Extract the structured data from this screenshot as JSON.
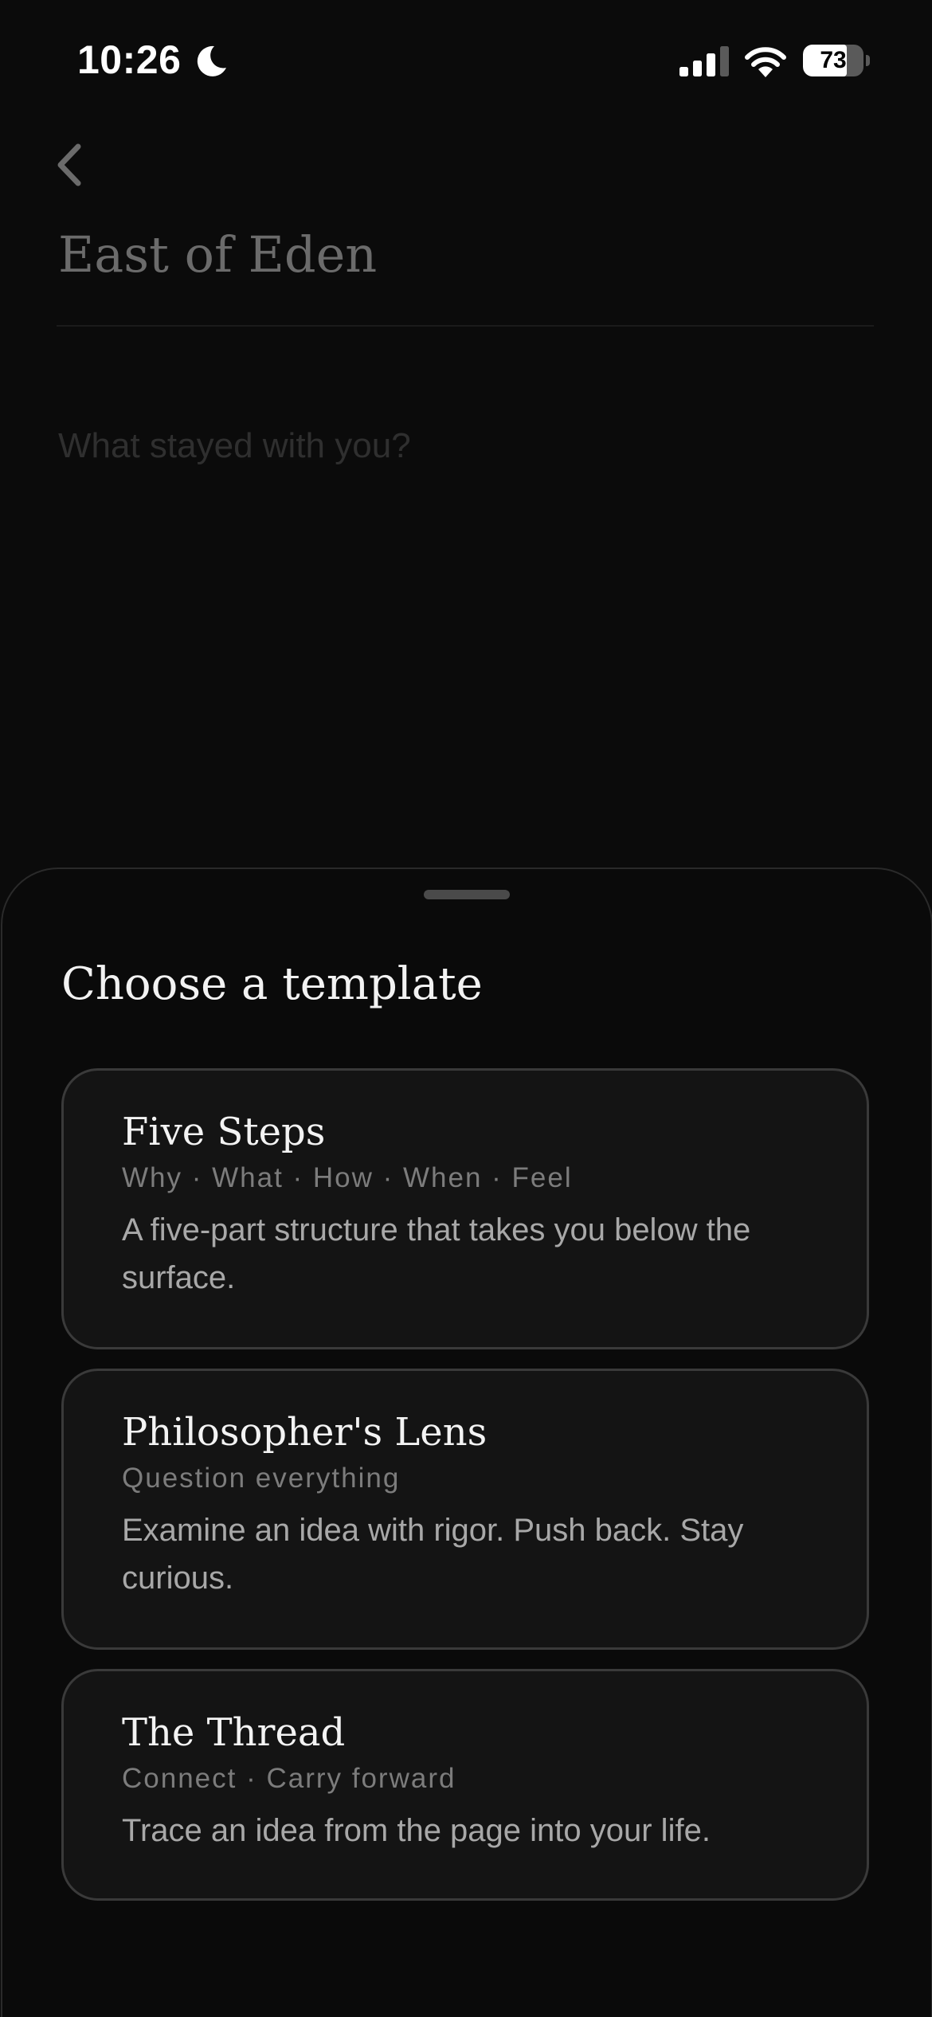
{
  "status_bar": {
    "time": "10:26",
    "battery_percent": "73",
    "battery_level": 0.73,
    "icons": [
      "moon-icon",
      "cellular-signal-icon",
      "wifi-icon",
      "battery-icon"
    ]
  },
  "editor": {
    "back_icon": "chevron-left-icon",
    "book_title": "East of Eden",
    "notes_placeholder": "What stayed with you?"
  },
  "sheet": {
    "title": "Choose a template",
    "templates": [
      {
        "name": "Five Steps",
        "tagline": "Why · What · How · When · Feel",
        "description": "A five-part structure that takes you below the surface."
      },
      {
        "name": "Philosopher's Lens",
        "tagline": "Question everything",
        "description": "Examine an idea with rigor. Push back. Stay curious."
      },
      {
        "name": "The Thread",
        "tagline": "Connect · Carry forward",
        "description": "Trace an idea from the page into your life."
      }
    ]
  },
  "colors": {
    "background": "#0b0b0b",
    "sheet_background": "#0a0a0a",
    "card_background": "#141414",
    "card_border": "#3a3a3a",
    "title_text": "#f2f2f2",
    "tagline_text": "#7c7c7c",
    "description_text": "#a8a8a8"
  }
}
